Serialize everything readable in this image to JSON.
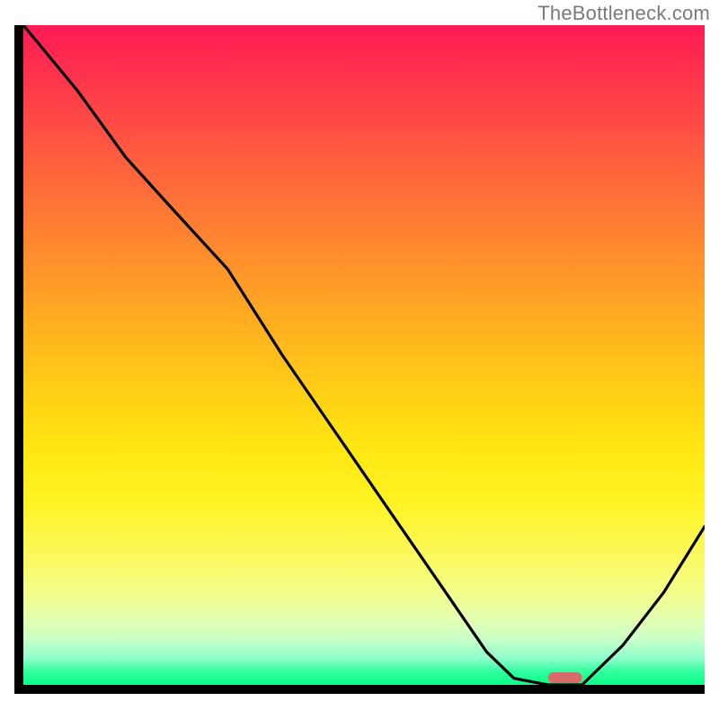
{
  "watermark": "TheBottleneck.com",
  "chart_data": {
    "type": "line",
    "title": "",
    "xlabel": "",
    "ylabel": "",
    "xlim": [
      0,
      100
    ],
    "ylim": [
      0,
      100
    ],
    "grid": false,
    "legend": false,
    "series": [
      {
        "name": "bottleneck-curve",
        "x": [
          0,
          8,
          15,
          22,
          30,
          38,
          46,
          54,
          62,
          68,
          72,
          77,
          82,
          88,
          94,
          100
        ],
        "values": [
          100,
          90,
          80,
          72,
          63,
          50,
          38,
          26,
          14,
          5,
          1,
          0,
          0,
          6,
          14,
          24
        ]
      }
    ],
    "marker": {
      "name": "optimal-range",
      "x_start": 77,
      "x_end": 82,
      "color": "#d96a6a"
    },
    "background_gradient_stops": [
      {
        "pos": 0.0,
        "color": "#ff1a55"
      },
      {
        "pos": 0.34,
        "color": "#ff8a2e"
      },
      {
        "pos": 0.64,
        "color": "#ffe612"
      },
      {
        "pos": 0.9,
        "color": "#e4ffb0"
      },
      {
        "pos": 1.0,
        "color": "#0aff88"
      }
    ]
  }
}
